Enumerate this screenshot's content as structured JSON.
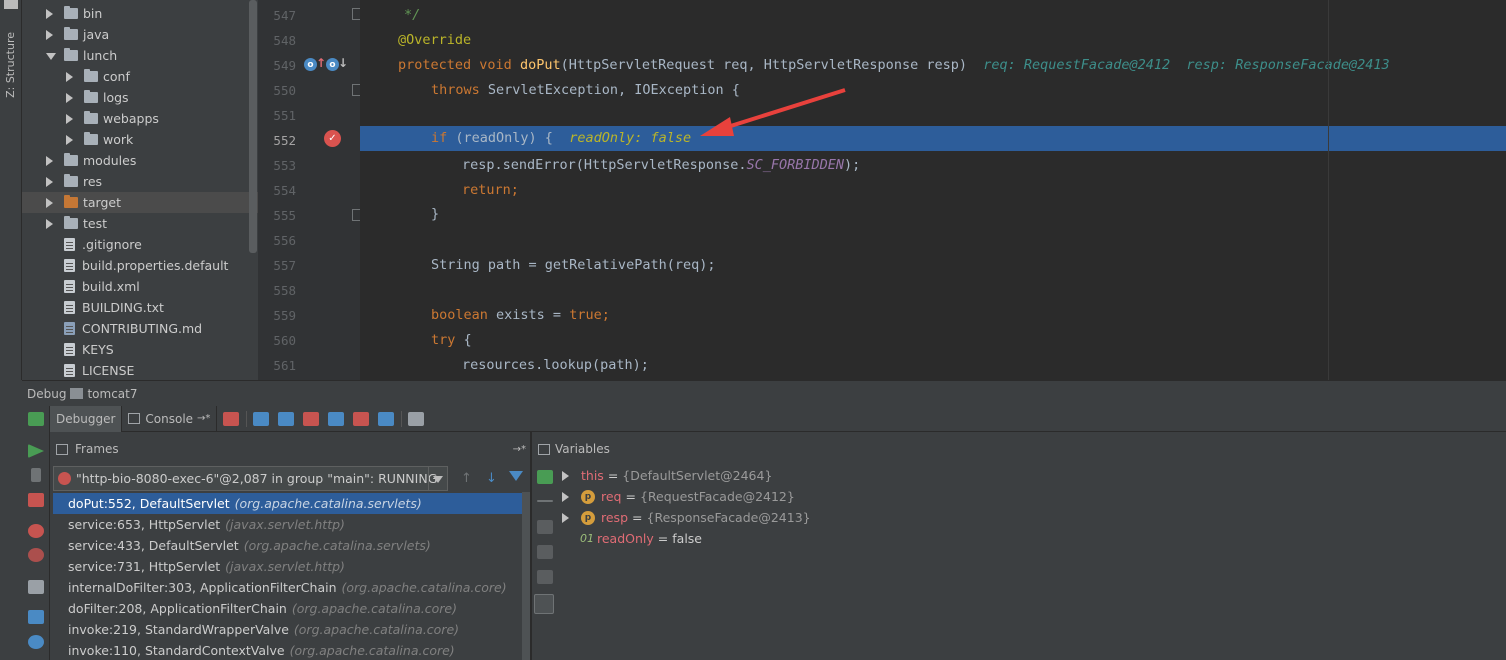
{
  "side_strip": {
    "structure_label": "Z: Structure"
  },
  "tree": {
    "items": [
      {
        "label": "bin",
        "type": "folder",
        "depth": 1,
        "arrow": "right"
      },
      {
        "label": "java",
        "type": "folder",
        "depth": 1,
        "arrow": "right"
      },
      {
        "label": "lunch",
        "type": "folder",
        "depth": 1,
        "arrow": "down"
      },
      {
        "label": "conf",
        "type": "folder",
        "depth": 2,
        "arrow": "right"
      },
      {
        "label": "logs",
        "type": "folder",
        "depth": 2,
        "arrow": "right"
      },
      {
        "label": "webapps",
        "type": "folder",
        "depth": 2,
        "arrow": "right"
      },
      {
        "label": "work",
        "type": "folder",
        "depth": 2,
        "arrow": "right"
      },
      {
        "label": "modules",
        "type": "folder",
        "depth": 1,
        "arrow": "right"
      },
      {
        "label": "res",
        "type": "folder",
        "depth": 1,
        "arrow": "right"
      },
      {
        "label": "target",
        "type": "folder-orange",
        "depth": 1,
        "arrow": "right",
        "selected": true
      },
      {
        "label": "test",
        "type": "folder",
        "depth": 1,
        "arrow": "right"
      },
      {
        "label": ".gitignore",
        "type": "file",
        "depth": 1
      },
      {
        "label": "build.properties.default",
        "type": "file",
        "depth": 1
      },
      {
        "label": "build.xml",
        "type": "file",
        "depth": 1
      },
      {
        "label": "BUILDING.txt",
        "type": "file",
        "depth": 1
      },
      {
        "label": "CONTRIBUTING.md",
        "type": "file-md",
        "depth": 1
      },
      {
        "label": "KEYS",
        "type": "file",
        "depth": 1
      },
      {
        "label": "LICENSE",
        "type": "file",
        "depth": 1
      }
    ]
  },
  "editor": {
    "line_numbers": [
      "547",
      "548",
      "549",
      "550",
      "551",
      "552",
      "553",
      "554",
      "555",
      "556",
      "557",
      "558",
      "559",
      "560",
      "561"
    ],
    "highlight_line": "552",
    "lines": {
      "l547": "*/",
      "l548": "@Override",
      "l549_kw": "protected void",
      "l549_fn": "doPut",
      "l549_rest": "(HttpServletRequest req, HttpServletResponse resp)",
      "l549_inline": "req: RequestFacade@2412  resp: ResponseFacade@2413",
      "l550_kw": "throws",
      "l550_rest": " ServletException, IOException {",
      "l552_kw": "if",
      "l552_rest": " (readOnly) {",
      "l552_inline": "readOnly: false",
      "l553_a": "resp.sendError(HttpServletResponse.",
      "l553_b": "SC_FORBIDDEN",
      "l553_c": ");",
      "l554_kw": "return;",
      "l555": "}",
      "l557": "String path = getRelativePath(req);",
      "l559_kw": "boolean",
      "l559_mid": " exists = ",
      "l559_kw2": "true;",
      "l560_kw": "try",
      "l560_rest": " {",
      "l561": "resources.lookup(path);"
    },
    "annotation_arrow_color": "#e8413c"
  },
  "debug": {
    "title": "Debug",
    "config": "tomcat7",
    "tabs": {
      "debugger": "Debugger",
      "console": "Console"
    },
    "console_suffix": "→*"
  },
  "frames": {
    "header": "Frames",
    "header_suffix": "→*",
    "thread": "\"http-bio-8080-exec-6\"@2,087 in group \"main\": RUNNING",
    "rows": [
      {
        "method": "doPut:552, DefaultServlet",
        "pkg": "(org.apache.catalina.servlets)",
        "selected": true
      },
      {
        "method": "service:653, HttpServlet",
        "pkg": "(javax.servlet.http)"
      },
      {
        "method": "service:433, DefaultServlet",
        "pkg": "(org.apache.catalina.servlets)"
      },
      {
        "method": "service:731, HttpServlet",
        "pkg": "(javax.servlet.http)"
      },
      {
        "method": "internalDoFilter:303, ApplicationFilterChain",
        "pkg": "(org.apache.catalina.core)"
      },
      {
        "method": "doFilter:208, ApplicationFilterChain",
        "pkg": "(org.apache.catalina.core)"
      },
      {
        "method": "invoke:219, StandardWrapperValve",
        "pkg": "(org.apache.catalina.core)"
      },
      {
        "method": "invoke:110, StandardContextValve",
        "pkg": "(org.apache.catalina.core)"
      }
    ]
  },
  "variables": {
    "header": "Variables",
    "rows": [
      {
        "name": "this",
        "value": "{DefaultServlet@2464}",
        "icon": "none"
      },
      {
        "name": "req",
        "value": "{RequestFacade@2412}",
        "icon": "p"
      },
      {
        "name": "resp",
        "value": "{ResponseFacade@2413}",
        "icon": "p"
      },
      {
        "name": "readOnly",
        "value": "false",
        "icon": "field"
      }
    ]
  }
}
